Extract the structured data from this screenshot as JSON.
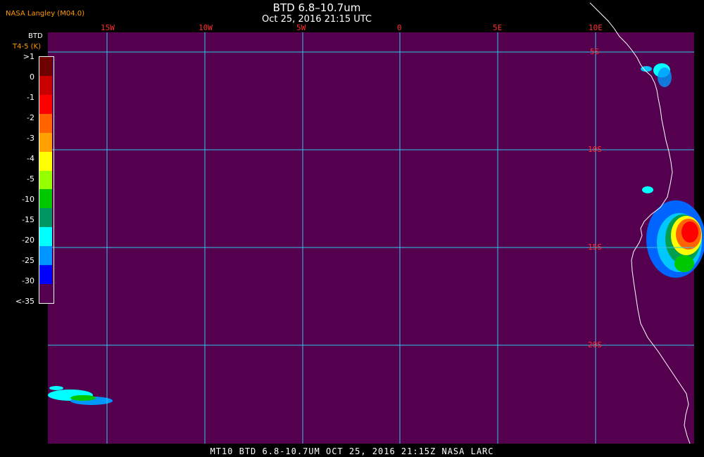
{
  "credit": "NASA Langley (M04.0)",
  "title": "BTD 6.8–10.7um",
  "subtitle": "Oct 25, 2016 21:15 UTC",
  "footer": "MT10  BTD 6.8-10.7UM  OCT 25, 2016 21:15Z  NASA LARC",
  "legend": {
    "title": "BTD",
    "subtitle": "T4-5 (K)",
    "labels": [
      ">1",
      "0",
      "-1",
      "-2",
      "-3",
      "-4",
      "-5",
      "-10",
      "-15",
      "-20",
      "-25",
      "-30",
      "<-35"
    ],
    "colors": [
      "#6e0000",
      "#c80000",
      "#ff0000",
      "#ff6400",
      "#ffa000",
      "#ffff00",
      "#96ff00",
      "#00c800",
      "#009664",
      "#00ffff",
      "#0096ff",
      "#0000ff",
      "#55004f"
    ]
  },
  "map": {
    "background_color": "#55004f",
    "grid_color": "#30c8e6",
    "coast_color": "#ffffff",
    "lon_labels": [
      "15W",
      "10W",
      "5W",
      "0",
      "5E",
      "10E"
    ],
    "lat_labels": [
      "5S",
      "10S",
      "15S",
      "20S"
    ]
  }
}
